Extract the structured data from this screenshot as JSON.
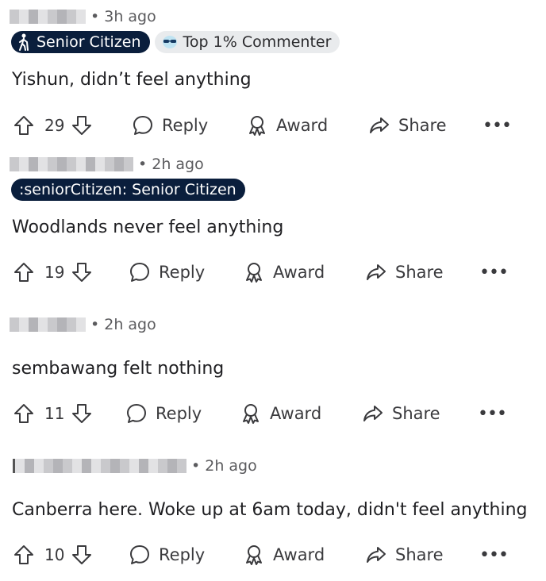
{
  "comments": [
    {
      "timestamp": "• 3h ago",
      "flairs": [
        {
          "text": "Senior Citizen",
          "icon": "person-walking-cane-icon",
          "style": "dark"
        },
        {
          "text": "Top 1% Commenter",
          "icon": "sunglasses-badge-icon",
          "style": "light"
        }
      ],
      "body": "Yishun, didn’t feel anything",
      "votes": "29",
      "reply": "Reply",
      "award": "Award",
      "share": "Share",
      "more": "•••"
    },
    {
      "timestamp": "• 2h ago",
      "flairs": [
        {
          "text": ":seniorCitizen: Senior Citizen",
          "style": "dark"
        }
      ],
      "body": "Woodlands never feel anything",
      "votes": "19",
      "reply": "Reply",
      "award": "Award",
      "share": "Share",
      "more": "•••"
    },
    {
      "timestamp": "• 2h ago",
      "flairs": [],
      "body": "sembawang felt nothing",
      "votes": "11",
      "reply": "Reply",
      "award": "Award",
      "share": "Share",
      "more": "•••"
    },
    {
      "timestamp": "• 2h ago",
      "flairs": [],
      "body": "Canberra here. Woke up at 6am today, didn't feel anything",
      "votes": "10",
      "reply": "Reply",
      "award": "Award",
      "share": "Share",
      "more": "•••"
    }
  ],
  "colors": {
    "flair_dark": "#0a1e3c",
    "flair_light": "#e9ebed",
    "text": "#1f1f22",
    "muted": "#5b5b5e"
  }
}
